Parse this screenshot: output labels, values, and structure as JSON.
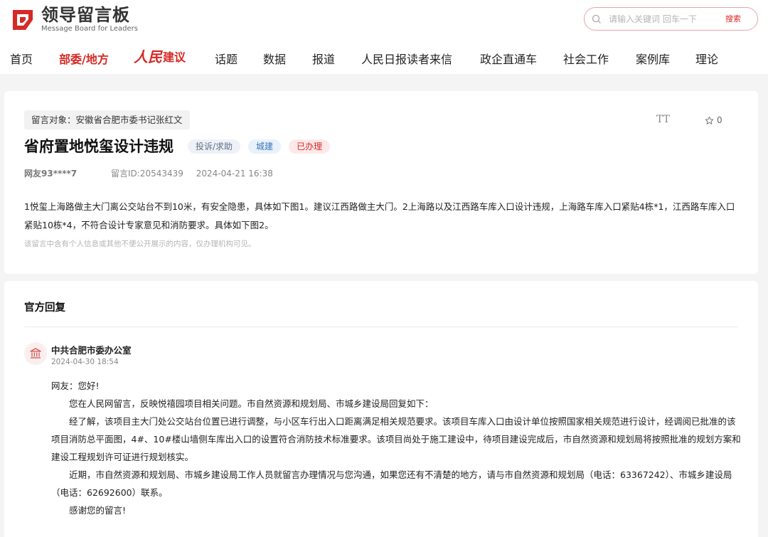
{
  "header": {
    "logo_cn": "领导留言板",
    "logo_en": "Message Board for Leaders",
    "search_placeholder": "请输入关键词 回车一下",
    "search_button": "搜索"
  },
  "nav": {
    "items": [
      "首页",
      "部委/地方",
      "话题",
      "数据",
      "报道",
      "人民日报读者来信",
      "政企直通车",
      "社会工作",
      "案例库",
      "理论"
    ],
    "brand_script": "人民",
    "brand_text": "建议"
  },
  "message": {
    "target": "留言对象：安徽省合肥市委书记张红文",
    "font_toggle": "TT",
    "fav_count": "0",
    "title": "省府置地悦玺设计违规",
    "chips": [
      "投诉/求助",
      "城建",
      "已办理"
    ],
    "author": "网友93****7",
    "message_id": "留言ID:20543439",
    "datetime": "2024-04-21 16:38",
    "body": "1悦玺上海路做主大门离公交站台不到10米，有安全隐患，具体如下图1。建议江西路做主大门。2上海路以及江西路车库入口设计违规，上海路车库入口紧贴4栋*1，江西路车库入口紧贴10栋*4，不符合设计专家意见和消防要求。具体如下图2。",
    "privacy_note": "该留言中含有个人信息或其他不便公开展示的内容，仅办理机构可见。"
  },
  "reply": {
    "heading": "官方回复",
    "org_name": "中共合肥市委办公室",
    "org_time": "2024-04-30 18:54",
    "greeting": "网友：您好!",
    "paragraphs": [
      "您在人民网留言，反映悦禧园项目相关问题。市自然资源和规划局、市城乡建设局回复如下：",
      "经了解，该项目主大门处公交站台位置已进行调整，与小区车行出入口距离满足相关规范要求。该项目车库入口由设计单位按照国家相关规范进行设计，经调阅已批准的该项目消防总平面图，4#、10#楼山墙侧车库出入口的设置符合消防技术标准要求。该项目尚处于施工建设中，待项目建设完成后，市自然资源和规划局将按照批准的规划方案和建设工程规划许可证进行规划核实。",
      "近期，市自然资源和规划局、市城乡建设局工作人员就留言办理情况与您沟通，如果您还有不清楚的地方，请与市自然资源和规划局（电话：63367242）、市城乡建设局（电话：62692600）联系。",
      "感谢您的留言!"
    ]
  },
  "colors": {
    "brand": "#d52a26",
    "background": "#f4f4f5"
  }
}
